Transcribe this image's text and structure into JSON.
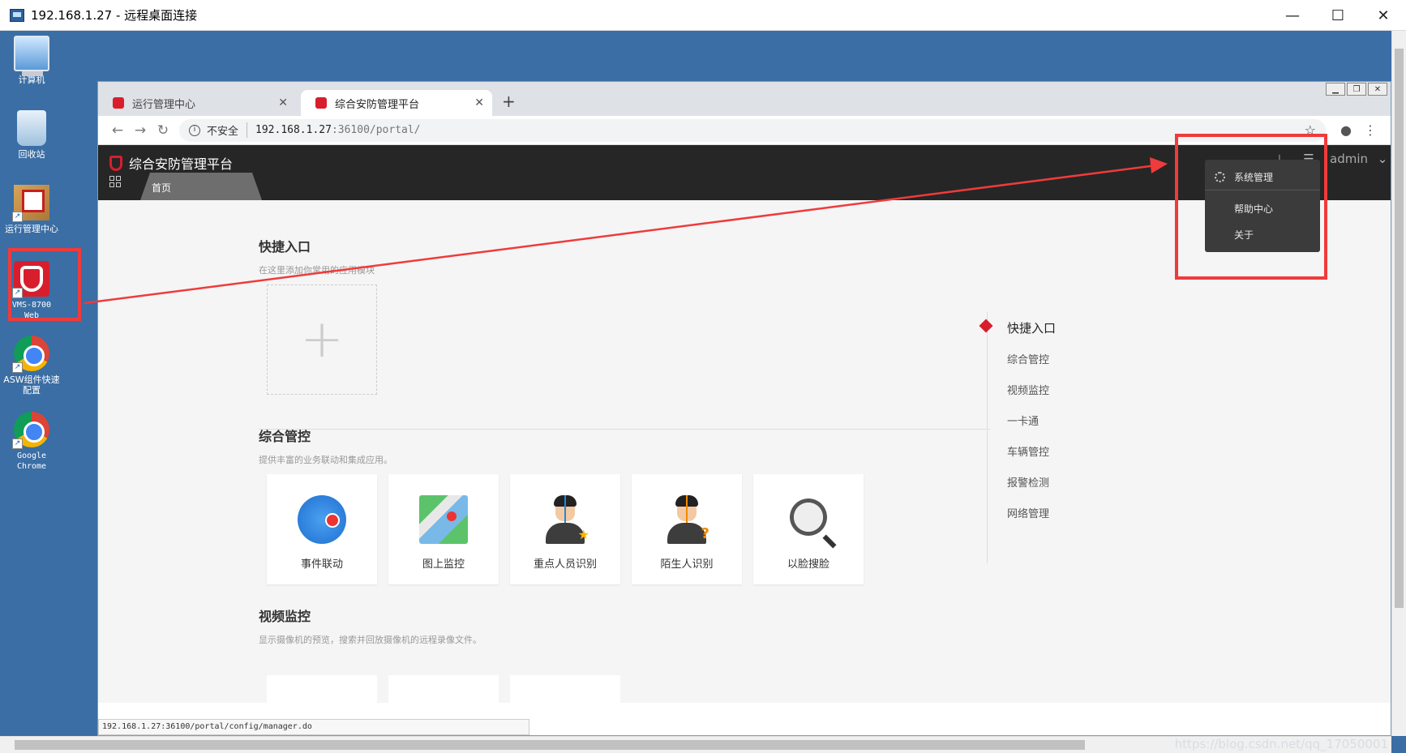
{
  "rdp": {
    "title": "192.168.1.27 - 远程桌面连接",
    "minimize": "—",
    "maximize": "☐",
    "close": "✕"
  },
  "desktop_icons": [
    {
      "label": "计算机",
      "icon": "computer-icon"
    },
    {
      "label": "回收站",
      "icon": "recycle-bin-icon"
    },
    {
      "label": "运行管理中心",
      "icon": "management-center-icon"
    },
    {
      "label": "VMS-8700 Web",
      "icon": "vms-shield-icon"
    },
    {
      "label": "ASW组件快速配置",
      "icon": "chrome-icon"
    },
    {
      "label": "Google Chrome",
      "icon": "chrome-icon"
    }
  ],
  "browser": {
    "tabs": [
      {
        "label": "运行管理中心",
        "active": false
      },
      {
        "label": "综合安防管理平台",
        "active": true
      }
    ],
    "new_tab": "+",
    "insecure_label": "不安全",
    "url_host": "192.168.1.27",
    "url_path": ":36100/portal/",
    "status_url": "192.168.1.27:36100/portal/config/manager.do"
  },
  "app": {
    "title": "综合安防管理平台",
    "home_tab": "首页",
    "user": "admin",
    "menu": {
      "items": [
        "系统管理",
        "帮助中心",
        "关于"
      ]
    },
    "sections": [
      {
        "title": "快捷入口",
        "desc": "在这里添加你常用的应用模块"
      },
      {
        "title": "综合管控",
        "desc": "提供丰富的业务联动和集成应用。"
      },
      {
        "title": "视频监控",
        "desc": "显示摄像机的预览，搜索并回放摄像机的远程录像文件。"
      }
    ],
    "add_symbol": "+",
    "cards": [
      {
        "label": "事件联动",
        "icon": "event-linkage-icon"
      },
      {
        "label": "图上监控",
        "icon": "map-monitor-icon"
      },
      {
        "label": "重点人员识别",
        "icon": "key-person-icon"
      },
      {
        "label": "陌生人识别",
        "icon": "stranger-icon"
      },
      {
        "label": "以脸搜脸",
        "icon": "face-search-icon"
      }
    ],
    "anchor_nav": [
      "快捷入口",
      "综合管控",
      "视频监控",
      "一卡通",
      "车辆管控",
      "报警检测",
      "网络管理"
    ]
  },
  "watermark": "https://blog.csdn.net/qq_17050001",
  "colors": {
    "desktop": "#3a6ea5",
    "brand_red": "#d81e2c",
    "annotation_red": "#ef3b3b",
    "header_dark": "#262626"
  }
}
